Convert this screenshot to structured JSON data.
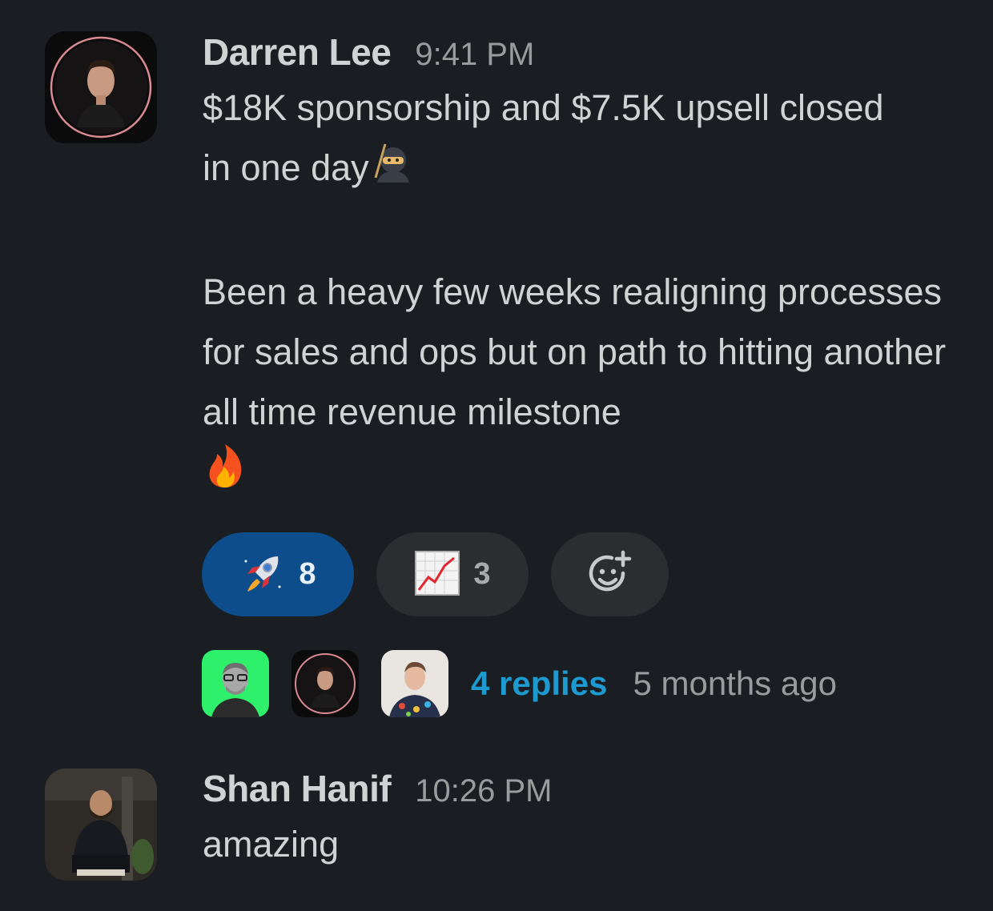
{
  "messages": [
    {
      "author": "Darren Lee",
      "time": "9:41 PM",
      "line1": "$18K sponsorship and $7.5K upsell closed",
      "line2": "in one day",
      "para2": "Been a heavy few weeks realigning processes for sales and ops but on path to hitting another all time revenue milestone"
    },
    {
      "author": "Shan Hanif",
      "time": "10:26 PM",
      "text": "amazing"
    }
  ],
  "reactions": [
    {
      "emoji": "rocket-emoji",
      "count": "8",
      "active": true
    },
    {
      "emoji": "chart-increasing-emoji",
      "count": "3",
      "active": false
    }
  ],
  "add_reaction_icon": "add-reaction-icon",
  "thread": {
    "replies": "4 replies",
    "ago": "5 months ago"
  },
  "colors": {
    "background": "#1a1d21",
    "active_reaction": "#0d4d8c",
    "link": "#1d9bd1"
  }
}
